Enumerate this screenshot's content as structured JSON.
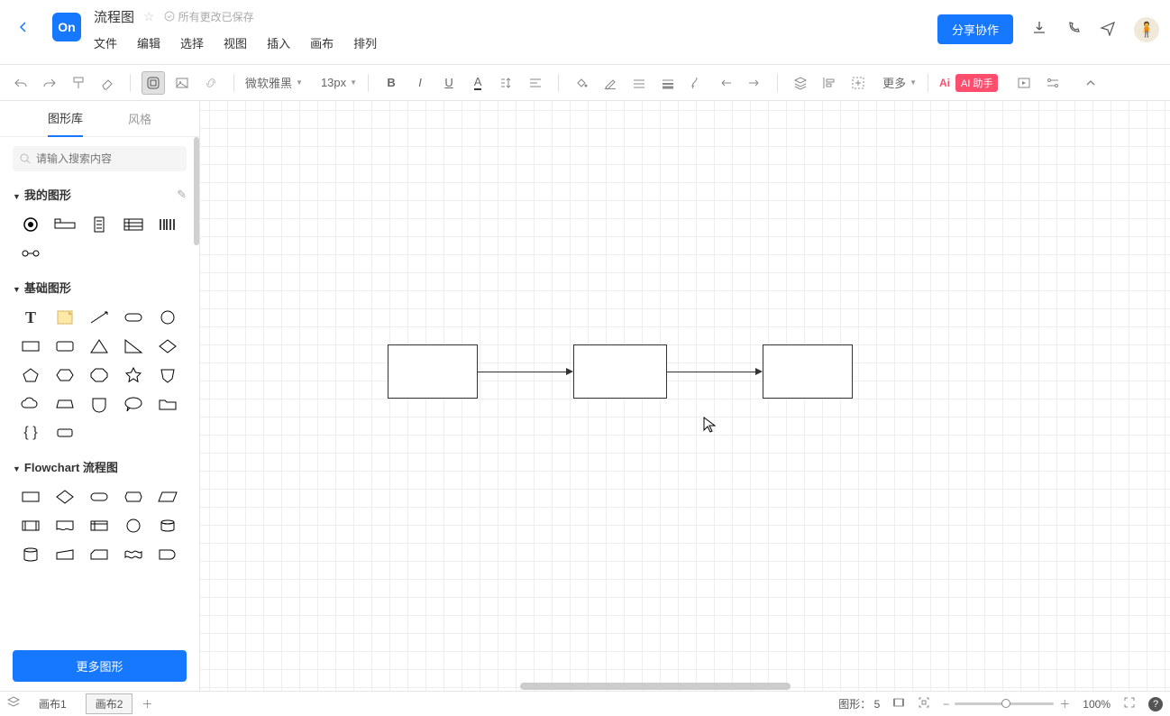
{
  "header": {
    "logo_text": "On",
    "doc_title": "流程图",
    "save_status": "所有更改已保存",
    "menus": [
      "文件",
      "编辑",
      "选择",
      "视图",
      "插入",
      "画布",
      "排列"
    ],
    "share_label": "分享协作"
  },
  "toolbar": {
    "font_family": "微软雅黑",
    "font_size": "13px",
    "more_label": "更多",
    "ai_label": "Ai",
    "ai_pill": "AI 助手"
  },
  "sidebar": {
    "tabs": {
      "shapes": "图形库",
      "style": "风格"
    },
    "search_placeholder": "请输入搜索内容",
    "groups": {
      "my_shapes": "我的图形",
      "basic_shapes": "基础图形",
      "flowchart": "Flowchart 流程图"
    },
    "more_shapes_label": "更多图形"
  },
  "statusbar": {
    "sheets": [
      "画布1",
      "画布2"
    ],
    "active_sheet": 1,
    "shape_count_label": "图形：",
    "shape_count": "5",
    "zoom_label": "100%"
  }
}
